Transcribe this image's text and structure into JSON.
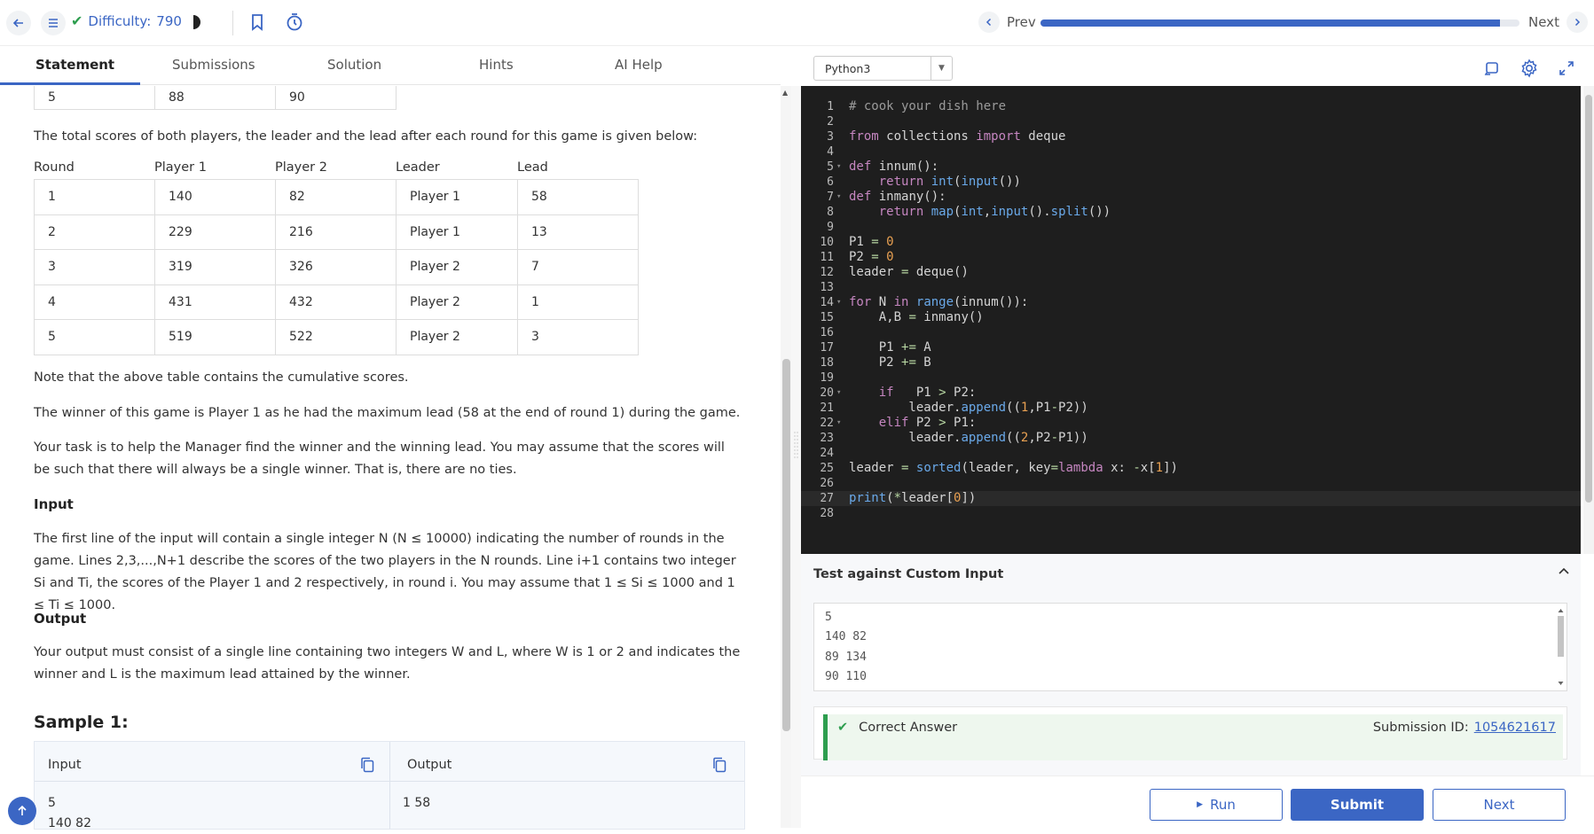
{
  "topbar": {
    "difficulty_label": "Difficulty:",
    "difficulty_value": "790",
    "prev_label": "Prev",
    "next_label": "Next",
    "progress_fraction": 0.96
  },
  "tabs": [
    {
      "label": "Statement",
      "active": true
    },
    {
      "label": "Submissions",
      "active": false
    },
    {
      "label": "Solution",
      "active": false
    },
    {
      "label": "Hints",
      "active": false
    },
    {
      "label": "AI Help",
      "active": false
    }
  ],
  "statement": {
    "partial_row": [
      "5",
      "88",
      "90"
    ],
    "intro": "The total scores of both players, the leader and the lead after each round for this game is given below:",
    "headers": [
      "Round",
      "Player 1",
      "Player 2",
      "Leader",
      "Lead"
    ],
    "rows": [
      [
        "1",
        "140",
        "82",
        "Player 1",
        "58"
      ],
      [
        "2",
        "229",
        "216",
        "Player 1",
        "13"
      ],
      [
        "3",
        "319",
        "326",
        "Player 2",
        "7"
      ],
      [
        "4",
        "431",
        "432",
        "Player 2",
        "1"
      ],
      [
        "5",
        "519",
        "522",
        "Player 2",
        "3"
      ]
    ],
    "note": "Note that the above table contains the cumulative scores.",
    "winner": "The winner of this game is Player 1 as he had the maximum lead (58 at the end of round 1) during the game.",
    "task": "Your task is to help the Manager find the winner and the winning lead. You may assume that the scores will be such that there will always be a single winner. That is, there are no ties.",
    "input_heading": "Input",
    "input_text": "The first line of the input will contain a single integer N (N ≤ 10000) indicating the number of rounds in the game. Lines 2,3,...,N+1 describe the scores of the two players in the N rounds. Line i+1 contains two integer Si and Ti, the scores of the Player 1 and 2 respectively, in round i. You may assume that 1 ≤ Si ≤ 1000 and 1 ≤ Ti ≤ 1000.",
    "output_heading": "Output",
    "output_text": "Your output must consist of a single line containing two integers W and L, where W is 1 or 2 and indicates the winner and L is the maximum lead attained by the winner.",
    "sample_title": "Sample 1:",
    "sample_input_label": "Input",
    "sample_output_label": "Output",
    "sample_input_lines": [
      "5",
      "140 82"
    ],
    "sample_output": "1 58"
  },
  "editor": {
    "language": "Python3",
    "line_numbers": [
      "1",
      "2",
      "3",
      "4",
      "5",
      "6",
      "7",
      "8",
      "9",
      "10",
      "11",
      "12",
      "13",
      "14",
      "15",
      "16",
      "17",
      "18",
      "19",
      "20",
      "21",
      "22",
      "23",
      "24",
      "25",
      "26",
      "27",
      "28"
    ]
  },
  "custom_input": {
    "title": "Test against Custom Input",
    "lines": [
      "5",
      "140 82",
      "89 134",
      "90 110"
    ]
  },
  "result": {
    "status": "Correct Answer",
    "submission_label": "Submission ID:",
    "submission_id": "1054621617"
  },
  "bottom": {
    "run_label": "Run",
    "submit_label": "Submit",
    "next_label": "Next"
  }
}
